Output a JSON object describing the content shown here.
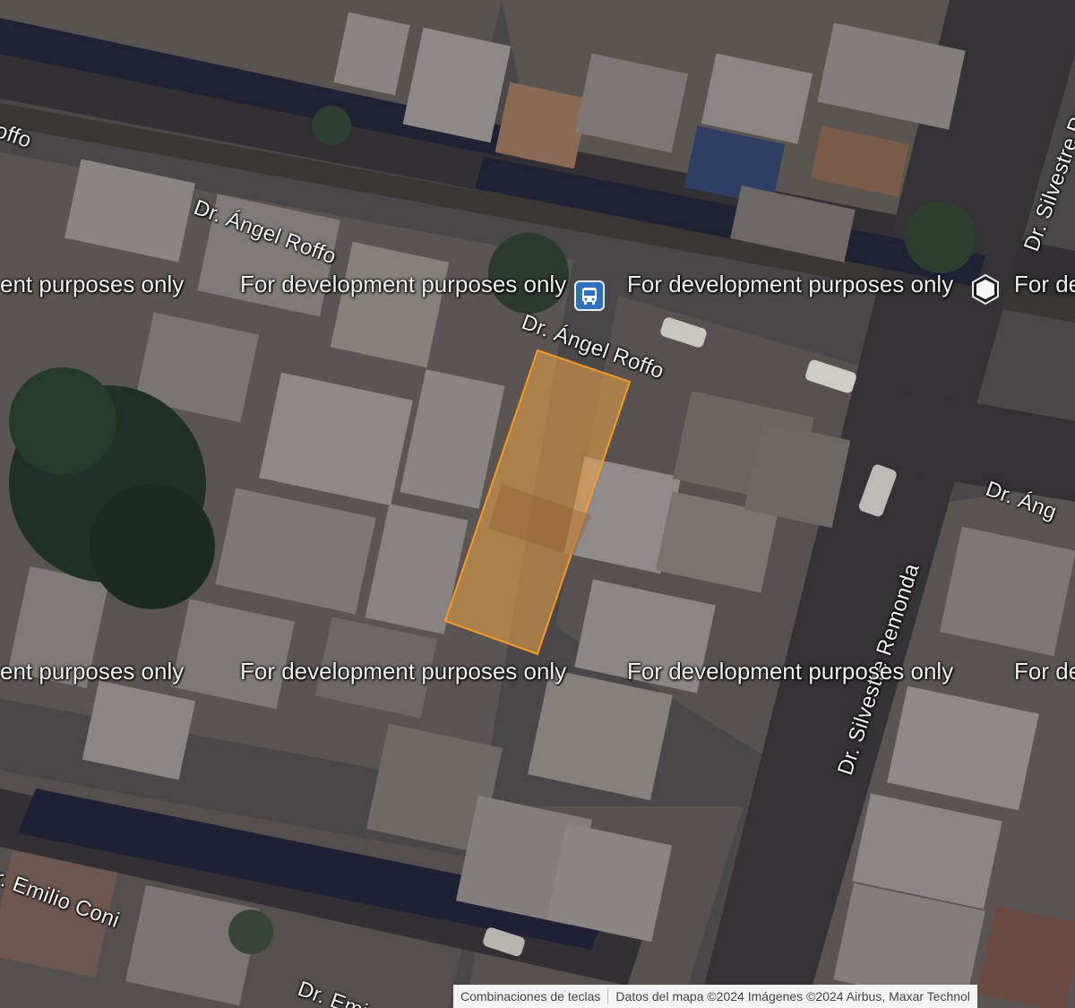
{
  "map": {
    "streets": [
      {
        "id": "offo-top-left",
        "text": "offo"
      },
      {
        "id": "roffo-upper",
        "text": "Dr. Ángel Roffo"
      },
      {
        "id": "roffo-lower",
        "text": "Dr. Ángel Roffo"
      },
      {
        "id": "silvestre-top",
        "text": "Dr. Silvestre Re"
      },
      {
        "id": "angel-right",
        "text": "Dr. Áng"
      },
      {
        "id": "remonda",
        "text": "Dr. Silvestre Remonda"
      },
      {
        "id": "coni",
        "text": "r. Emilio Coni"
      },
      {
        "id": "emilio-bottom",
        "text": "Dr. Emi"
      }
    ],
    "watermarks": [
      "ent purposes only",
      "For development purposes only",
      "For development purposes only",
      "For de",
      "ent purposes only",
      "For development purposes only",
      "For development purposes only",
      "For de"
    ],
    "icons": {
      "bus_stop": "bus-icon",
      "marker": "hexagon-marker-icon"
    },
    "colors": {
      "parcel_fill": "#f0a445",
      "parcel_stroke": "#f59a2a",
      "bus": "#2f6fbf"
    }
  },
  "attribution": {
    "shortcuts": "Combinaciones de teclas",
    "data": "Datos del mapa ©2024 Imágenes ©2024 Airbus, Maxar Technol"
  }
}
